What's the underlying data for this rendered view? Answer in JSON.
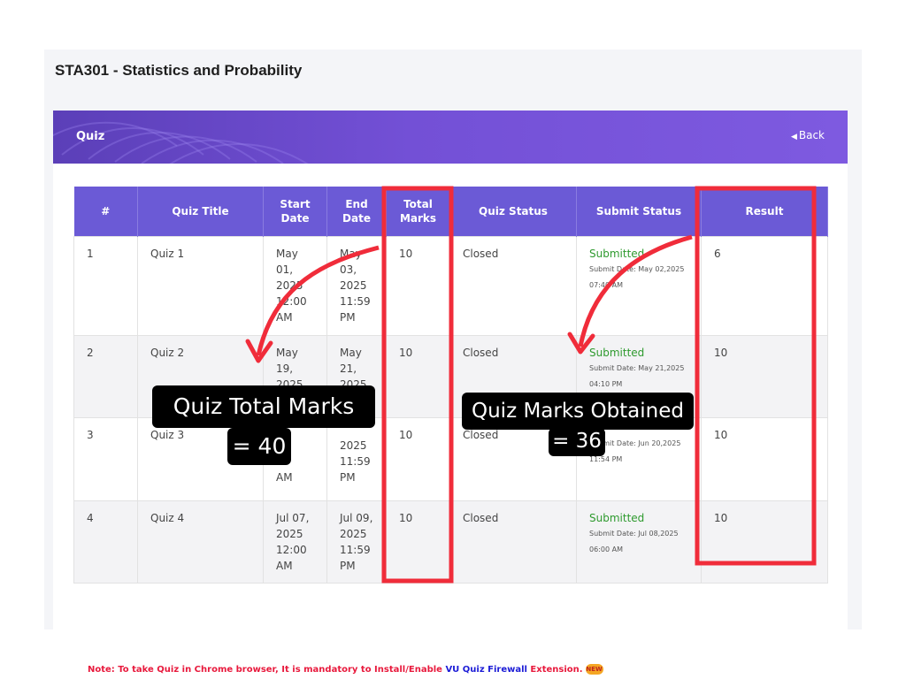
{
  "course": {
    "title": "STA301 - Statistics and Probability"
  },
  "card": {
    "title": "Quiz",
    "back_label": "Back"
  },
  "table": {
    "headers": [
      "#",
      "Quiz Title",
      "Start Date",
      "End Date",
      "Total Marks",
      "Quiz Status",
      "Submit Status",
      "Result"
    ],
    "rows": [
      {
        "num": "1",
        "title": "Quiz 1",
        "start": "May 01, 2025 12:00 AM",
        "end": "May 03, 2025 11:59 PM",
        "total": "10",
        "status": "Closed",
        "submit": "Submitted",
        "submit_date": "Submit Date: May 02,2025 07:40 AM",
        "result": "6"
      },
      {
        "num": "2",
        "title": "Quiz 2",
        "start": "May 19, 2025 12:00",
        "end": "May 21, 2025 11:59",
        "total": "10",
        "status": "Closed",
        "submit": "Submitted",
        "submit_date": "Submit Date: May 21,2025 04:10 PM",
        "result": "10"
      },
      {
        "num": "3",
        "title": "Quiz 3",
        "start": "AM",
        "end": "2025 11:59 PM",
        "total": "10",
        "status": "Closed",
        "submit": "",
        "submit_date": "Submit Date: Jun 20,2025 11:54 PM",
        "result": "10"
      },
      {
        "num": "4",
        "title": "Quiz 4",
        "start": "Jul 07, 2025 12:00 AM",
        "end": "Jul 09, 2025 11:59 PM",
        "total": "10",
        "status": "Closed",
        "submit": "Submitted",
        "submit_date": "Submit Date: Jul 08,2025 06:00 AM",
        "result": "10"
      }
    ]
  },
  "note": {
    "prefix": "Note: To take Quiz in Chrome browser, It is mandatory to Install/Enable ",
    "link": "VU Quiz Firewall",
    "suffix": " Extension.",
    "badge": "NEW"
  },
  "annotations": {
    "total_line1": "Quiz Total Marks",
    "total_line2": "= 40",
    "obtained_line1": "Quiz Marks Obtained",
    "obtained_line2": "= 36",
    "highlight_color": "#f02c3a"
  },
  "colors": {
    "header_purple": "#6b5ad6",
    "banner_purple": "#7350d6",
    "green": "#2e9a2e",
    "red": "#e04848",
    "note_red": "#e8193c",
    "link_blue": "#1c1cd6"
  }
}
